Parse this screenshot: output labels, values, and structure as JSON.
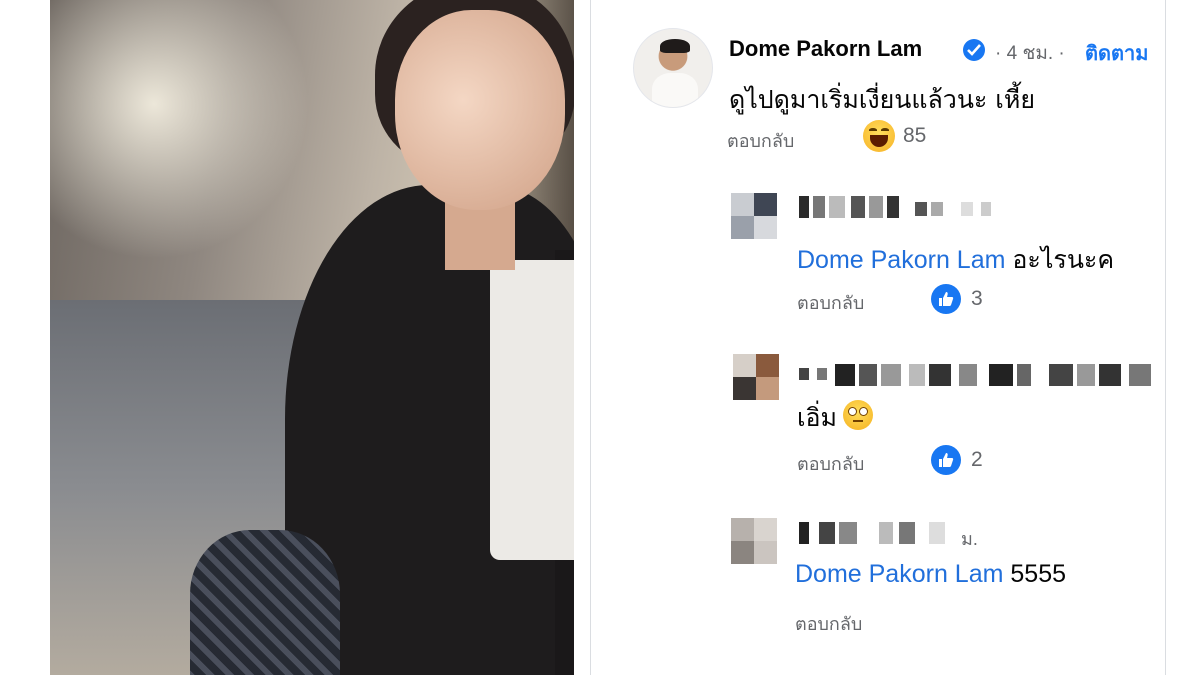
{
  "main_comment": {
    "author": "Dome Pakorn Lam",
    "time": "· 4 ชม. ·",
    "follow_label": "ติดตาม",
    "text": "ดูไปดูมาเริ่มเงี่ยนแล้วนะ  เหี้ย",
    "reply_label": "ตอบกลับ",
    "reaction": "haha-icon",
    "reaction_count": "85"
  },
  "replies": [
    {
      "mention": "Dome Pakorn Lam",
      "text": " อะไรนะค",
      "reply_label": "ตอบกลับ",
      "reaction": "like-icon",
      "reaction_count": "3"
    },
    {
      "text": "เอิ่ม",
      "emoji": "face-with-rolling-eyes-icon",
      "reply_label": "ตอบกลับ",
      "reaction": "like-icon",
      "reaction_count": "2"
    },
    {
      "redacted_tail": "ม.",
      "mention": "Dome Pakorn Lam",
      "text": " 5555",
      "reply_label": "ตอบกลับ"
    }
  ],
  "colors": {
    "accent": "#1877f2",
    "mention": "#216fdb",
    "secondary_text": "#65676b"
  }
}
